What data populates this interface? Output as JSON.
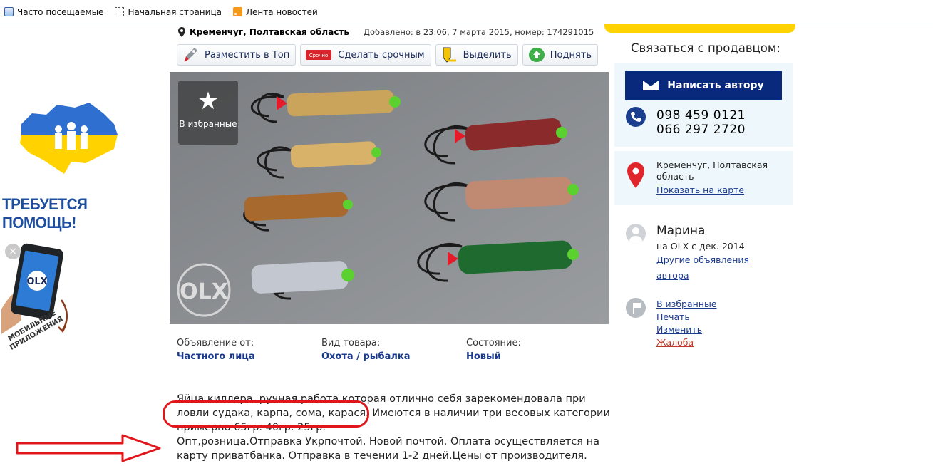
{
  "bookmarks": [
    {
      "label": "Часто посещаемые",
      "icon": "visited-icon"
    },
    {
      "label": "Начальная страница",
      "icon": "home-page-icon"
    },
    {
      "label": "Лента новостей",
      "icon": "rss-icon"
    }
  ],
  "banner": {
    "help_text": "ТРЕБУЕТСЯ ПОМОЩЬ!",
    "mobile_apps_line1": "МОБИЛЬНЫЕ",
    "mobile_apps_line2": "ПРИЛОЖЕНИЯ",
    "close": "×",
    "phone_logo": "OLX"
  },
  "listing": {
    "location": "Кременчуг, Полтавская область",
    "added": "Добавлено: в 23:06, 7 марта 2015, номер: 174291015",
    "actions": [
      {
        "label": "Разместить в Топ",
        "icon": "rocket-icon"
      },
      {
        "label": "Сделать срочным",
        "icon": "urgent-tag-icon"
      },
      {
        "label": "Выделить",
        "icon": "highlighter-icon"
      },
      {
        "label": "Поднять",
        "icon": "lift-up-icon"
      }
    ],
    "urgent_tag": "Срочно",
    "favorite_label": "В избранные",
    "watermark": "OLX",
    "params": [
      {
        "label": "Объявление от:",
        "value": "Частного лица"
      },
      {
        "label": "Вид товара:",
        "value": "Охота / рыбалка"
      },
      {
        "label": "Состояние:",
        "value": "Новый"
      }
    ],
    "description": [
      "Яйца киллера, ручная работа которая отлично себя зарекомендовала при",
      "ловли судака, карпа, сома, карася.  Имеются в наличии три весовых категории",
      "примерно 65гр. 40гр. 25гр.",
      "Опт,розница.Отправка Укрпочтой, Новой почтой. Оплата осуществляется на",
      "карту приватбанка. Отправка в течении 1-2 дней.Цены от производителя."
    ]
  },
  "seller": {
    "contact_title": "Связаться с продавцом:",
    "write_button": "Написать автору",
    "phones": [
      "098 459 0121",
      "066 297 2720"
    ],
    "location_line1": "Кременчуг, Полтавская",
    "location_line2": "область",
    "show_map": "Показать на карте",
    "name": "Марина",
    "since": "на OLX с дек. 2014",
    "other_ads_line1": "Другие объявления",
    "other_ads_line2": "автора",
    "links": [
      "В избранные",
      "Печать",
      "Изменить",
      "Жалоба"
    ]
  },
  "colors": {
    "brand_blue": "#08297c",
    "link_blue": "#1a3a8f",
    "accent_yellow": "#ffd200",
    "annotation_red": "#e0161b",
    "complaint": "#c0392b"
  }
}
